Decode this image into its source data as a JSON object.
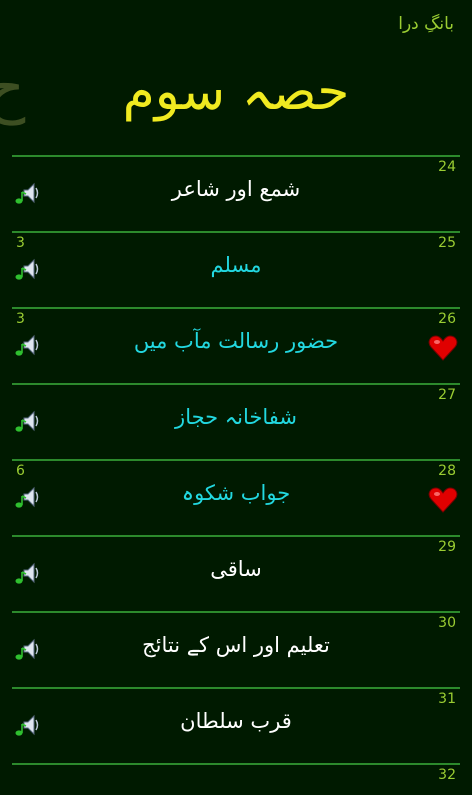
{
  "app_title": "بانگِ درا",
  "ghost_letter": "ح",
  "section_title": "حصہ سوم",
  "poems": [
    {
      "number": "24",
      "title": "شمع اور شاعر",
      "count": "",
      "color": "white",
      "favorite": false
    },
    {
      "number": "25",
      "title": "مسلم",
      "count": "3",
      "color": "cyan",
      "favorite": false
    },
    {
      "number": "26",
      "title": "حضور رسالت مآب میں",
      "count": "3",
      "color": "cyan",
      "favorite": true
    },
    {
      "number": "27",
      "title": "شفاخانہ حجاز",
      "count": "",
      "color": "cyan",
      "favorite": false
    },
    {
      "number": "28",
      "title": "جواب شکوہ",
      "count": "6",
      "color": "cyan",
      "favorite": true
    },
    {
      "number": "29",
      "title": "ساقی",
      "count": "",
      "color": "white",
      "favorite": false
    },
    {
      "number": "30",
      "title": "تعلیم اور اس کے نتائج",
      "count": "",
      "color": "white",
      "favorite": false
    },
    {
      "number": "31",
      "title": "قرب سلطان",
      "count": "",
      "color": "white",
      "favorite": false
    }
  ],
  "next_number": "32",
  "icons": {
    "speaker": "speaker-music-icon",
    "heart": "heart-icon"
  }
}
